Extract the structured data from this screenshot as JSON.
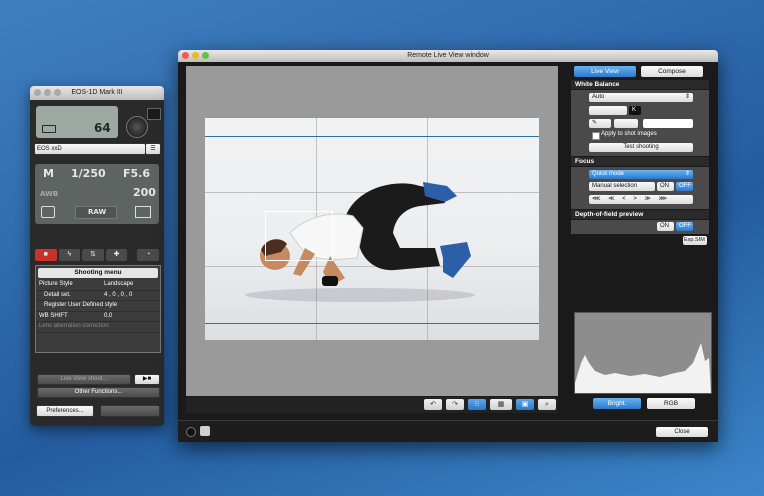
{
  "camera": {
    "title": "EOS-1D Mark III",
    "shots_remaining": "64",
    "camera_name": "EOS xxD",
    "mode": "M",
    "shutter": "1/250",
    "aperture": "F5.6",
    "wb": "AWB",
    "iso": "200",
    "quality": "RAW",
    "menu_title": "Shooting menu",
    "menu": [
      {
        "label": "Picture Style",
        "value": "Landscape"
      },
      {
        "label": "Detail set.",
        "value": "4 , 0 , 0 , 0"
      },
      {
        "label": "Register User Defined style",
        "value": ""
      },
      {
        "label": "WB SHIFT",
        "value": "0,0"
      },
      {
        "label": "Lens aberration correction",
        "value": ""
      }
    ],
    "live_view_button": "Live View shoot...",
    "other_functions": "Other Functions...",
    "preferences": "Preferences..."
  },
  "window": {
    "title": "Remote Live View window",
    "tabs": [
      "Live View",
      "Compose"
    ],
    "white_balance_title": "White Balance",
    "white_balance_value": "Auto",
    "apply_label": "Apply to shot images",
    "test_shooting": "Test shooting",
    "focus_title": "Focus",
    "focus_mode": "Quick mode",
    "af_selection": "Manual selection",
    "on": "ON",
    "off": "OFF",
    "dof_title": "Depth-of-field preview",
    "exp_sim": "Exp.SIM",
    "histogram_buttons": [
      "Bright.",
      "RGB"
    ],
    "close": "Close"
  },
  "colors": {
    "accent": "#2d79c9",
    "record": "#c8312c"
  }
}
